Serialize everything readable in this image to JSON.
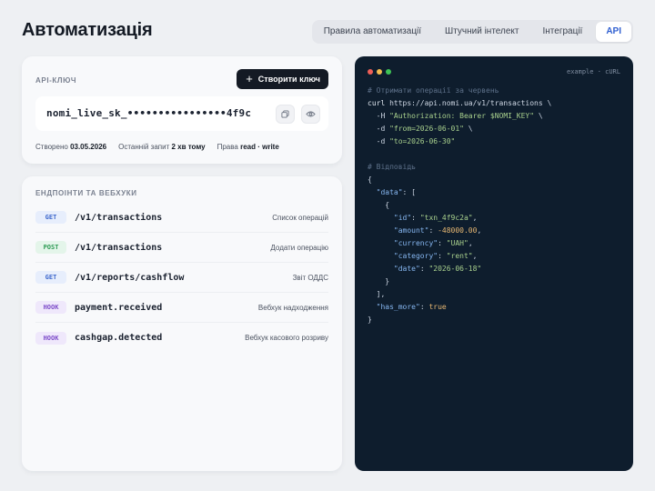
{
  "header": {
    "title": "Автоматизація",
    "tabs": [
      {
        "label": "Правила автоматизації",
        "active": false
      },
      {
        "label": "Штучний інтелект",
        "active": false
      },
      {
        "label": "Інтеграції",
        "active": false
      },
      {
        "label": "API",
        "active": true
      }
    ]
  },
  "api_key": {
    "section_label": "API-КЛЮЧ",
    "create_button": "Створити ключ",
    "key_value": "nomi_live_sk_••••••••••••••••4f9c",
    "created_label": "Створено",
    "created_value": "03.05.2026",
    "last_request_label": "Останній запит",
    "last_request_value": "2 хв тому",
    "rights_label": "Права",
    "rights_value": "read · write",
    "icons": {
      "copy": "copy-icon",
      "view": "eye-icon",
      "create": "plus-icon"
    }
  },
  "endpoints": {
    "section_label": "ЕНДПОІНТИ ТА ВЕБХУКИ",
    "items": [
      {
        "method": "GET",
        "path": "/v1/transactions",
        "description": "Список операцій"
      },
      {
        "method": "POST",
        "path": "/v1/transactions",
        "description": "Додати операцію"
      },
      {
        "method": "GET",
        "path": "/v1/reports/cashflow",
        "description": "Звіт ОДДС"
      },
      {
        "method": "HOOK",
        "path": "payment.received",
        "description": "Вебхук надходження"
      },
      {
        "method": "HOOK",
        "path": "cashgap.detected",
        "description": "Вебхук касового розриву"
      }
    ]
  },
  "code": {
    "lang": "example · cURL",
    "window_dots": [
      "#ef5f57",
      "#f4bd4f",
      "#3fc356"
    ],
    "lines": [
      [
        {
          "t": "# Отримати операції за червень",
          "c": "c-com"
        }
      ],
      [
        {
          "t": "curl ",
          "c": "c-cmd"
        },
        {
          "t": "https://api.nomi.ua/v1/transactions",
          "c": "c-url"
        },
        {
          "t": " \\",
          "c": "c-punc"
        }
      ],
      [
        {
          "t": "  -H ",
          "c": "c-flag"
        },
        {
          "t": "\"Authorization: Bearer $NOMI_KEY\"",
          "c": "c-str"
        },
        {
          "t": " \\",
          "c": "c-punc"
        }
      ],
      [
        {
          "t": "  -d ",
          "c": "c-flag"
        },
        {
          "t": "\"from=2026-06-01\"",
          "c": "c-str"
        },
        {
          "t": " \\",
          "c": "c-punc"
        }
      ],
      [
        {
          "t": "  -d ",
          "c": "c-flag"
        },
        {
          "t": "\"to=2026-06-30\"",
          "c": "c-str"
        }
      ],
      [
        {
          "t": "",
          "c": "c-punc"
        }
      ],
      [
        {
          "t": "# Відповідь",
          "c": "c-com"
        }
      ],
      [
        {
          "t": "{",
          "c": "c-punc"
        }
      ],
      [
        {
          "t": "  ",
          "c": "c-punc"
        },
        {
          "t": "\"data\"",
          "c": "c-key"
        },
        {
          "t": ": [",
          "c": "c-punc"
        }
      ],
      [
        {
          "t": "    {",
          "c": "c-punc"
        }
      ],
      [
        {
          "t": "      ",
          "c": "c-punc"
        },
        {
          "t": "\"id\"",
          "c": "c-key"
        },
        {
          "t": ": ",
          "c": "c-punc"
        },
        {
          "t": "\"txn_4f9c2a\"",
          "c": "c-str"
        },
        {
          "t": ",",
          "c": "c-punc"
        }
      ],
      [
        {
          "t": "      ",
          "c": "c-punc"
        },
        {
          "t": "\"amount\"",
          "c": "c-key"
        },
        {
          "t": ": ",
          "c": "c-punc"
        },
        {
          "t": "-48000.00",
          "c": "c-num"
        },
        {
          "t": ",",
          "c": "c-punc"
        }
      ],
      [
        {
          "t": "      ",
          "c": "c-punc"
        },
        {
          "t": "\"currency\"",
          "c": "c-key"
        },
        {
          "t": ": ",
          "c": "c-punc"
        },
        {
          "t": "\"UAH\"",
          "c": "c-str"
        },
        {
          "t": ",",
          "c": "c-punc"
        }
      ],
      [
        {
          "t": "      ",
          "c": "c-punc"
        },
        {
          "t": "\"category\"",
          "c": "c-key"
        },
        {
          "t": ": ",
          "c": "c-punc"
        },
        {
          "t": "\"rent\"",
          "c": "c-str"
        },
        {
          "t": ",",
          "c": "c-punc"
        }
      ],
      [
        {
          "t": "      ",
          "c": "c-punc"
        },
        {
          "t": "\"date\"",
          "c": "c-key"
        },
        {
          "t": ": ",
          "c": "c-punc"
        },
        {
          "t": "\"2026-06-18\"",
          "c": "c-str"
        }
      ],
      [
        {
          "t": "    }",
          "c": "c-punc"
        }
      ],
      [
        {
          "t": "  ],",
          "c": "c-punc"
        }
      ],
      [
        {
          "t": "  ",
          "c": "c-punc"
        },
        {
          "t": "\"has_more\"",
          "c": "c-key"
        },
        {
          "t": ": ",
          "c": "c-punc"
        },
        {
          "t": "true",
          "c": "c-bool"
        }
      ],
      [
        {
          "t": "}",
          "c": "c-punc"
        }
      ]
    ]
  }
}
